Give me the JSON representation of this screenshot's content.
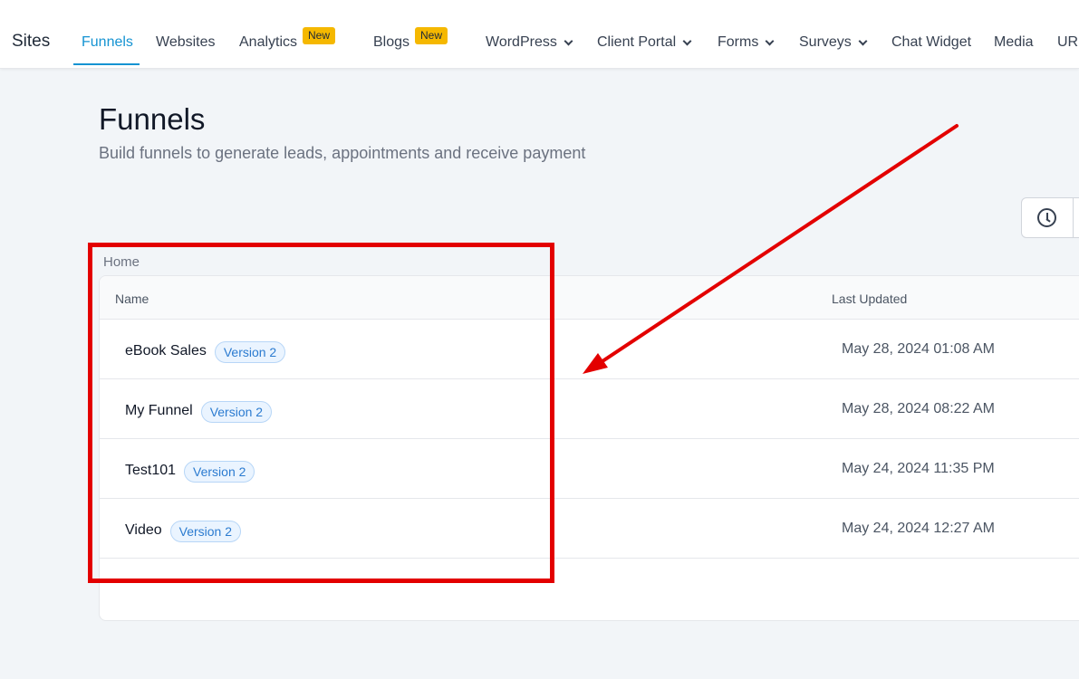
{
  "nav": {
    "brand": "Sites",
    "items": [
      {
        "label": "Funnels"
      },
      {
        "label": "Websites"
      },
      {
        "label": "Analytics",
        "badge": "New"
      },
      {
        "label": "Blogs",
        "badge": "New"
      },
      {
        "label": "WordPress"
      },
      {
        "label": "Client Portal"
      },
      {
        "label": "Forms"
      },
      {
        "label": "Surveys"
      },
      {
        "label": "Chat Widget"
      },
      {
        "label": "Media"
      },
      {
        "label": "URL"
      }
    ]
  },
  "header": {
    "title": "Funnels",
    "subtitle": "Build funnels to generate leads, appointments and receive payment"
  },
  "breadcrumb": "Home",
  "table": {
    "columns": {
      "name": "Name",
      "updated": "Last Updated"
    },
    "rows": [
      {
        "name": "eBook Sales",
        "version": "Version 2",
        "updated": "May 28, 2024 01:08 AM"
      },
      {
        "name": "My Funnel",
        "version": "Version 2",
        "updated": "May 28, 2024 08:22 AM"
      },
      {
        "name": "Test101",
        "version": "Version 2",
        "updated": "May 24, 2024 11:35 PM"
      },
      {
        "name": "Video",
        "version": "Version 2",
        "updated": "May 24, 2024 12:27 AM"
      }
    ]
  },
  "icons": {
    "history": "clock-icon",
    "dropdown": "chevron-down-icon"
  },
  "colors": {
    "accent": "#1593d2",
    "new_badge": "#f5b800",
    "annotation": "#e30000",
    "version_badge_text": "#2b7bd0"
  }
}
